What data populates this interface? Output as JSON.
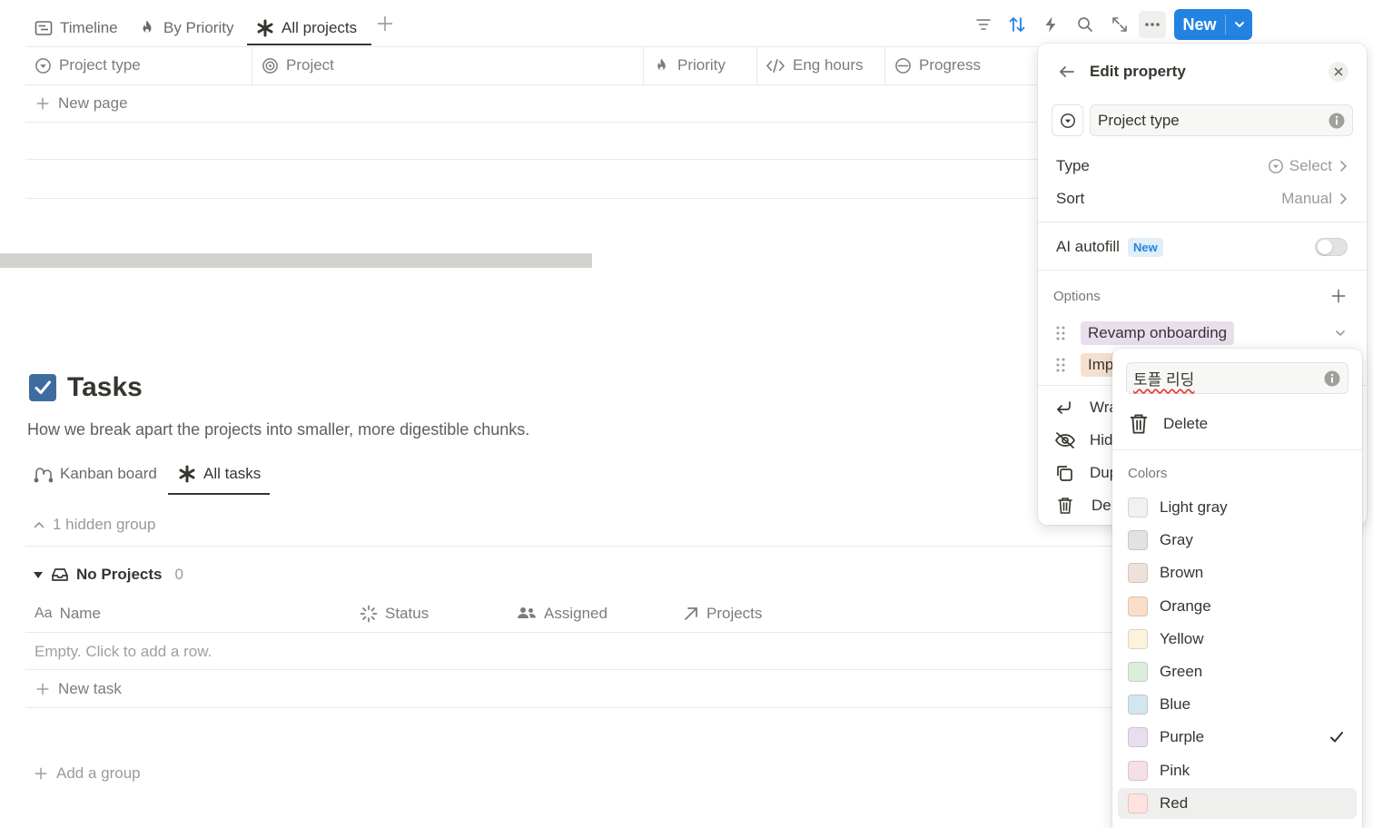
{
  "top_tabs": [
    {
      "label": "Timeline",
      "icon": "timeline-icon"
    },
    {
      "label": "By Priority",
      "icon": "flame-icon"
    },
    {
      "label": "All projects",
      "icon": "asterisk-icon",
      "active": true
    }
  ],
  "toolbar": {
    "new_label": "New",
    "icons": [
      "filter-icon",
      "sort-icon",
      "lightning-icon",
      "search-icon",
      "expand-icon",
      "more-icon"
    ]
  },
  "projects_table": {
    "columns": [
      {
        "label": "Project type",
        "icon": "select-icon"
      },
      {
        "label": "Project",
        "icon": "target-icon"
      },
      {
        "label": "Priority",
        "icon": "flame-icon"
      },
      {
        "label": "Eng hours",
        "icon": "code-icon"
      },
      {
        "label": "Progress",
        "icon": "progress-icon"
      }
    ],
    "new_page_label": "New page"
  },
  "tasks": {
    "title": "Tasks",
    "description": "How we break apart the projects into smaller, more digestible chunks.",
    "tabs": [
      {
        "label": "Kanban board",
        "icon": "kanban-icon"
      },
      {
        "label": "All tasks",
        "icon": "asterisk-icon",
        "active": true
      }
    ],
    "hidden_group_label": "1 hidden group",
    "group": {
      "label": "No Projects",
      "count": "0"
    },
    "columns": [
      {
        "label": "Name",
        "icon": "text-icon"
      },
      {
        "label": "Status",
        "icon": "status-icon"
      },
      {
        "label": "Assigned",
        "icon": "people-icon"
      },
      {
        "label": "Projects",
        "icon": "relation-arrow-icon"
      }
    ],
    "text_icon_glyph": "Aa",
    "empty_label": "Empty. Click to add a row.",
    "new_task_label": "New task",
    "add_group_label": "Add a group"
  },
  "edit_property": {
    "title": "Edit property",
    "name_value": "Project type",
    "type_label": "Type",
    "type_value": "Select",
    "sort_label": "Sort",
    "sort_value": "Manual",
    "ai_autofill_label": "AI autofill",
    "ai_badge": "New",
    "ai_autofill_on": false,
    "options_label": "Options",
    "options": [
      {
        "label": "Revamp onboarding",
        "color": "#e8deee"
      },
      {
        "label": "Imp",
        "color": "#f5e0d0"
      }
    ],
    "actions": [
      {
        "label": "Wra",
        "icon": "wrap-icon"
      },
      {
        "label": "Hid",
        "icon": "eye-off-icon"
      },
      {
        "label": "Dup",
        "icon": "duplicate-icon"
      },
      {
        "label": "De",
        "icon": "trash-icon"
      }
    ]
  },
  "option_menu": {
    "name_value": "토플 리딩",
    "delete_label": "Delete",
    "colors_label": "Colors",
    "colors": [
      {
        "label": "Light gray",
        "swatch": "#f1f1ef"
      },
      {
        "label": "Gray",
        "swatch": "#e3e2e0"
      },
      {
        "label": "Brown",
        "swatch": "#eee0da"
      },
      {
        "label": "Orange",
        "swatch": "#fadec9"
      },
      {
        "label": "Yellow",
        "swatch": "#fbf3db"
      },
      {
        "label": "Green",
        "swatch": "#dbeddb"
      },
      {
        "label": "Blue",
        "swatch": "#d3e5ef"
      },
      {
        "label": "Purple",
        "swatch": "#e8deee",
        "selected": true
      },
      {
        "label": "Pink",
        "swatch": "#f5e0e9"
      },
      {
        "label": "Red",
        "swatch": "#ffe2dd",
        "hovered": true
      }
    ]
  },
  "colors": {
    "accent": "#2383e2",
    "text": "#37352f",
    "muted": "#787774",
    "border": "#e9e9e7"
  }
}
